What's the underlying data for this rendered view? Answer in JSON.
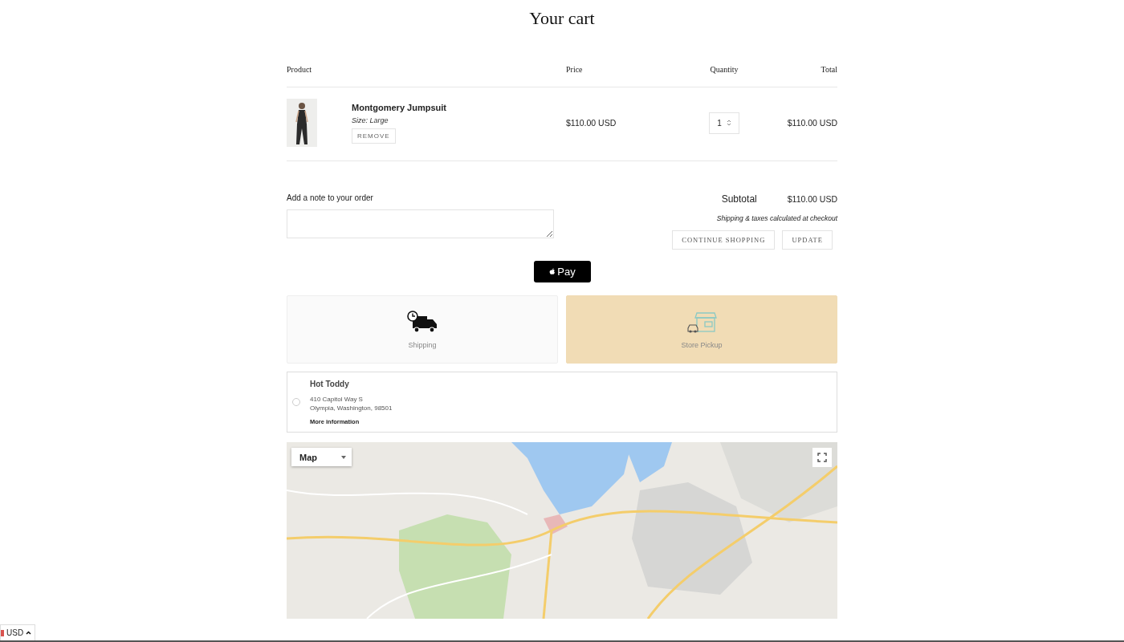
{
  "title": "Your cart",
  "table": {
    "columns": [
      "Product",
      "Price",
      "Quantity",
      "Total"
    ],
    "rows": [
      {
        "kind": "picture",
        "name": "Montgomery Jumpsuit",
        "variant": "Size: Large",
        "remove": "REMOVE",
        "price": "$110.00 USD",
        "quantity": "1",
        "total": "$110.00 USD"
      }
    ]
  },
  "note": {
    "label": "Add a note to your order"
  },
  "summary": {
    "subtotal_label": "Subtotal",
    "subtotal": "$110.00 USD",
    "hint": "Shipping & taxes calculated at checkout",
    "buttons": [
      "CONTINUE SHOPPING",
      "UPDATE"
    ]
  },
  "express": {
    "label": "Pay"
  },
  "delivery_methods": [
    {
      "kind": "shipping",
      "label": "Shipping",
      "selected": false
    },
    {
      "kind": "pickup",
      "label": "Store Pickup",
      "selected": true
    }
  ],
  "locations": [
    {
      "name": "Hot Toddy",
      "address": [
        "410 Capitol Way S",
        "Olympia, Washington, 98501"
      ],
      "link": "More information",
      "selected": false
    }
  ],
  "map": {
    "type_control": "Map"
  },
  "currency": {
    "code": "USD"
  }
}
